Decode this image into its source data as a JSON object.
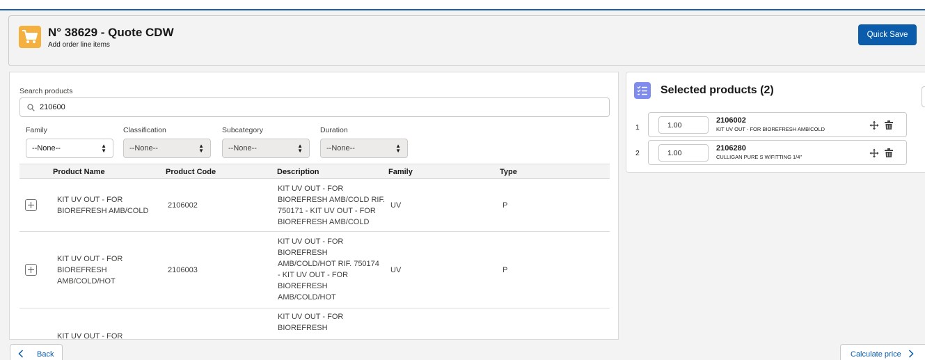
{
  "header": {
    "title": "N° 38629 - Quote CDW",
    "subtitle": "Add order line items",
    "icon": "shopping-cart-icon",
    "quick_save_label": "Quick Save"
  },
  "search": {
    "label": "Search products",
    "value": "210600"
  },
  "filters": [
    {
      "label": "Family",
      "value": "--None--",
      "disabled": false
    },
    {
      "label": "Classification",
      "value": "--None--",
      "disabled": true
    },
    {
      "label": "Subcategory",
      "value": "--None--",
      "disabled": true
    },
    {
      "label": "Duration",
      "value": "--None--",
      "disabled": true
    }
  ],
  "table": {
    "columns": [
      "Product Name",
      "Product Code",
      "Description",
      "Family",
      "Type"
    ],
    "rows": [
      {
        "name": [
          "KIT UV OUT - FOR",
          "BIOREFRESH AMB/COLD"
        ],
        "code": "2106002",
        "description": [
          "KIT UV OUT - FOR",
          "BIOREFRESH AMB/COLD RIF.",
          "750171 - KIT UV OUT - FOR",
          "BIOREFRESH AMB/COLD"
        ],
        "family": "UV",
        "type": "P"
      },
      {
        "name": [
          "KIT UV OUT - FOR",
          "BIOREFRESH",
          "AMB/COLD/HOT"
        ],
        "code": "2106003",
        "description": [
          "KIT UV OUT - FOR",
          "BIOREFRESH",
          "AMB/COLD/HOT RIF. 750174",
          "- KIT UV OUT - FOR",
          "BIOREFRESH",
          "AMB/COLD/HOT"
        ],
        "family": "UV",
        "type": "P"
      },
      {
        "name": [
          "KIT UV OUT - FOR"
        ],
        "code": "",
        "description": [
          "KIT UV OUT - FOR",
          "BIOREFRESH"
        ],
        "family": "",
        "type": ""
      }
    ]
  },
  "selected": {
    "title": "Selected products (2)",
    "icon": "checklist-icon",
    "items": [
      {
        "index": "1",
        "qty": "1.00",
        "code": "2106002",
        "desc": "KIT UV OUT - FOR BIOREFRESH AMB/COLD"
      },
      {
        "index": "2",
        "qty": "1.00",
        "code": "2106280",
        "desc": "CULLIGAN PURE S W/FITTING 1/4\""
      }
    ]
  },
  "footer": {
    "back_label": "Back",
    "calc_label": "Calculate price"
  },
  "colors": {
    "brand_blue": "#0b5cab",
    "cart_orange": "#f4b13f",
    "checklist_purple": "#7f8ced"
  }
}
